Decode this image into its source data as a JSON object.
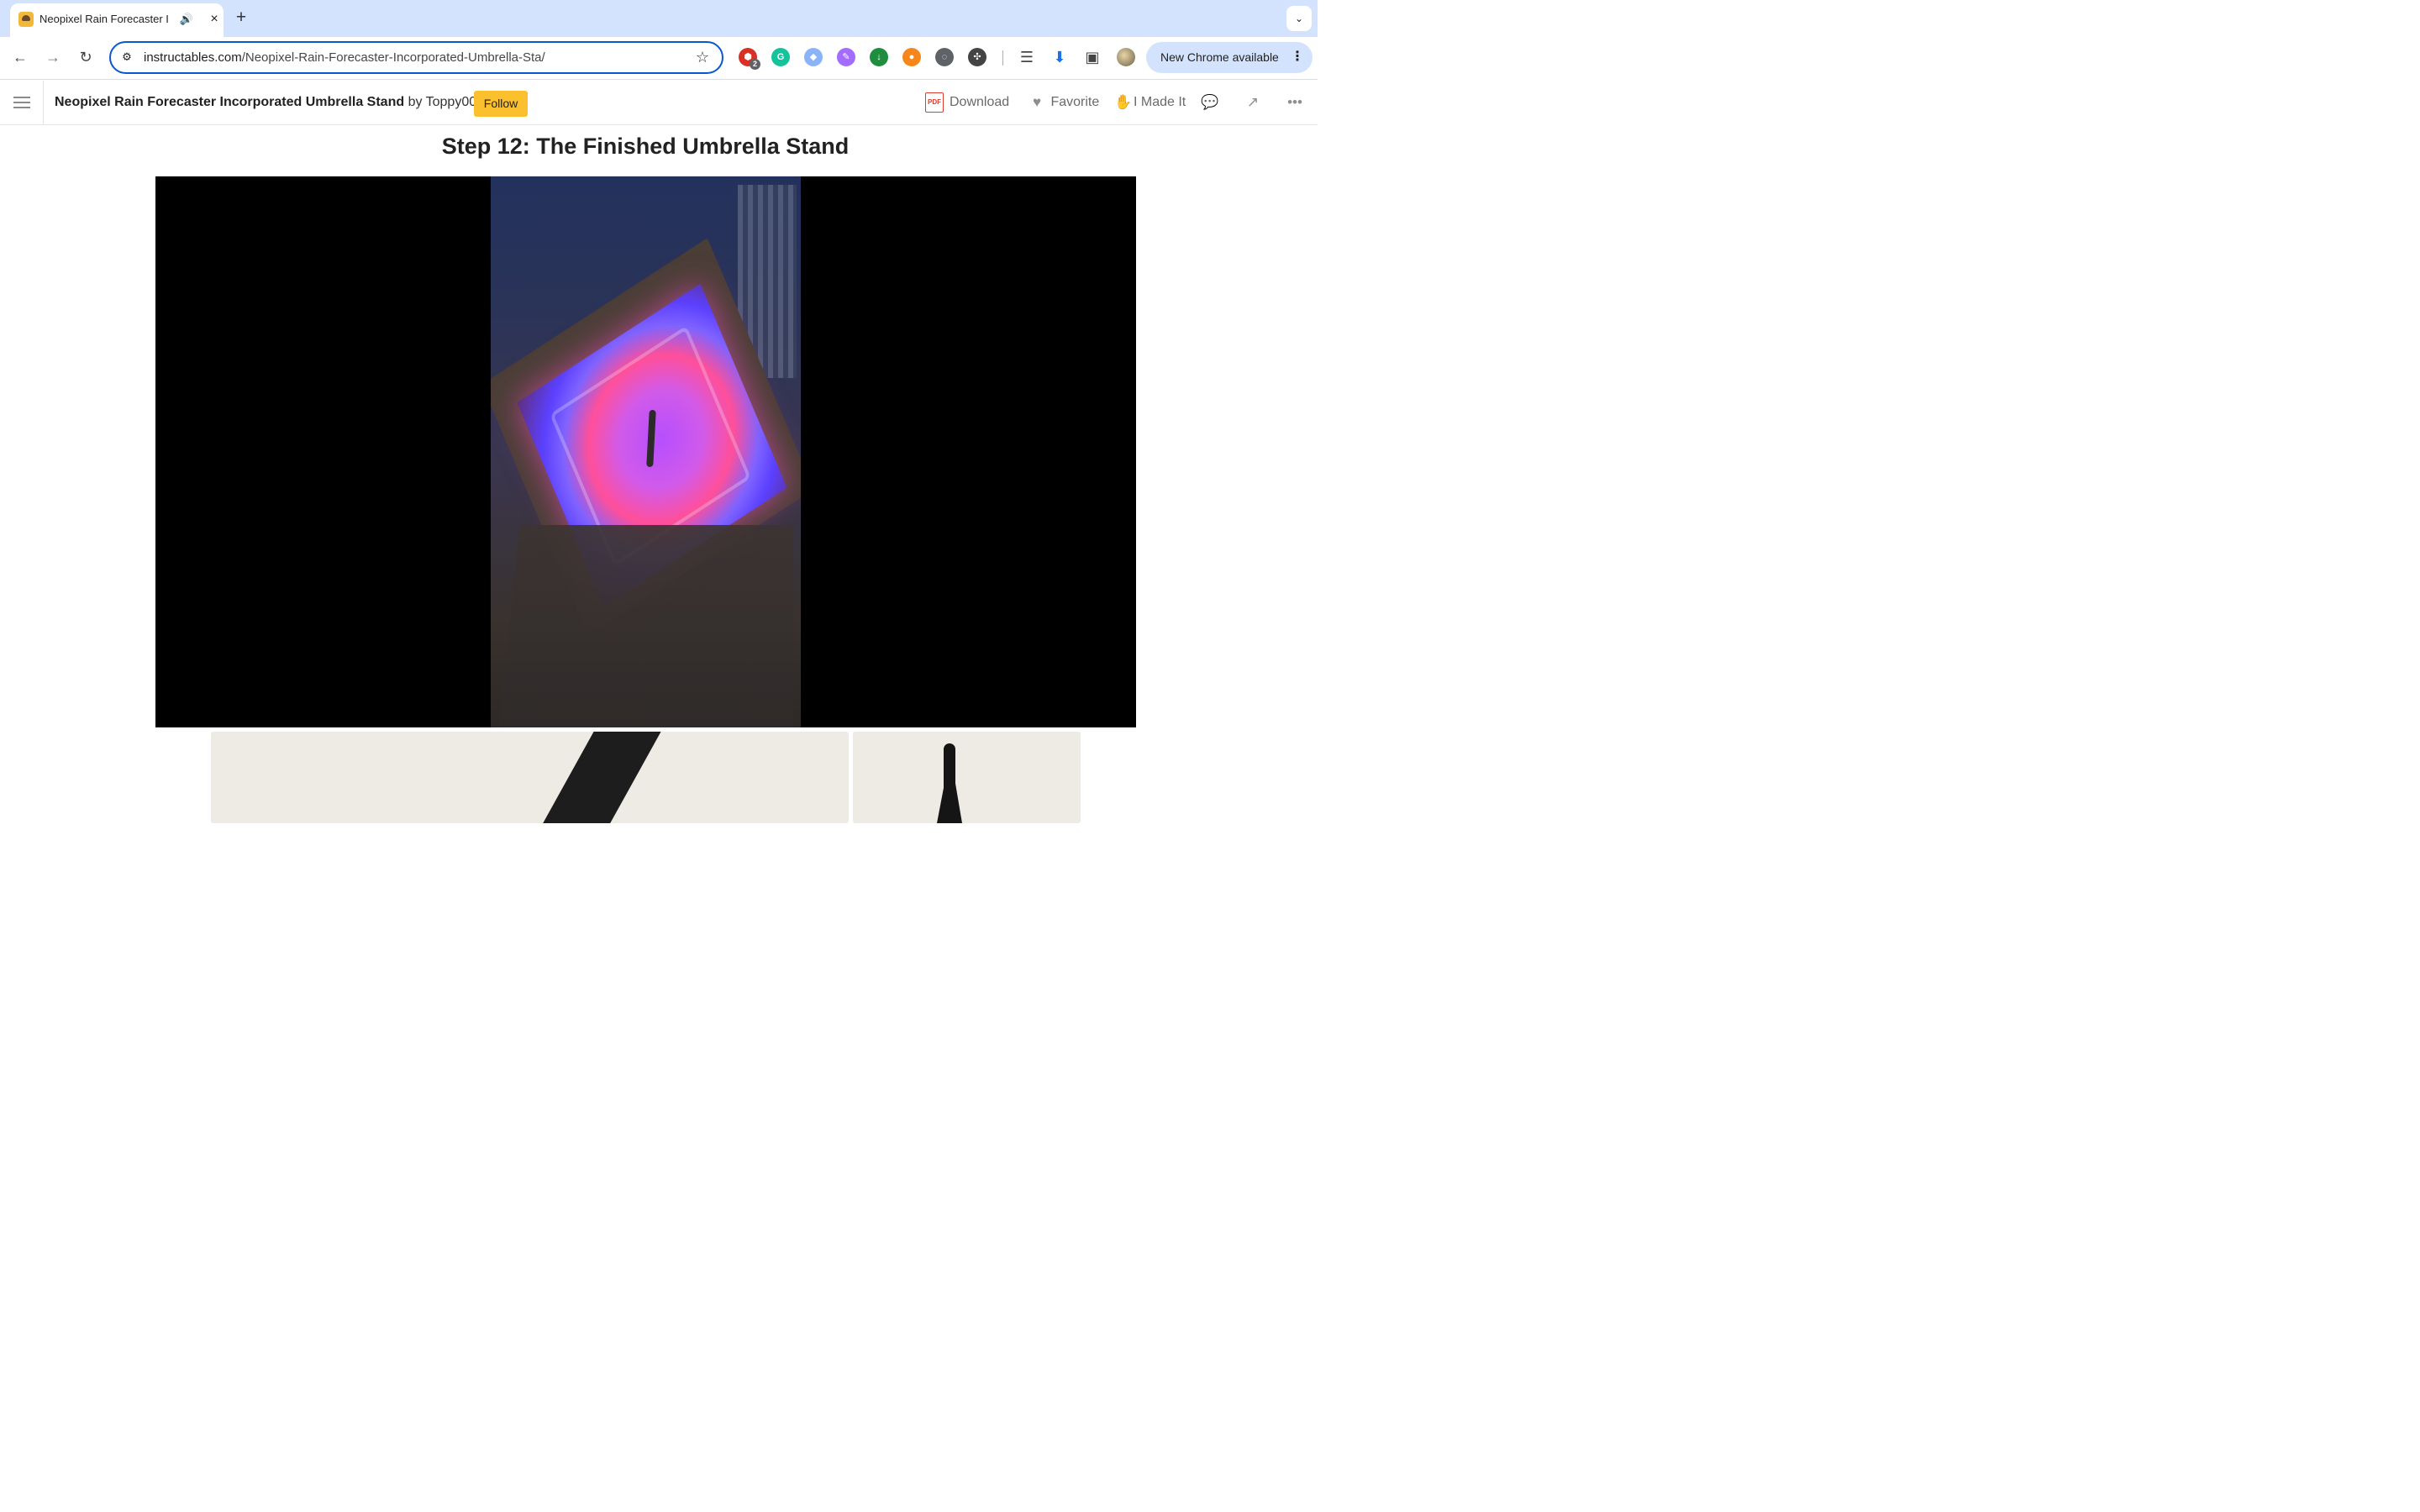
{
  "browser": {
    "tab": {
      "title": "Neopixel Rain Forecaster I",
      "favicon": "instructables-robot-icon",
      "audio_icon": "speaker-icon",
      "close_icon": "close-icon"
    },
    "new_tab_icon": "plus-icon",
    "tab_search_icon": "chevron-down-icon",
    "nav": {
      "back_icon": "arrow-left-icon",
      "forward_icon": "arrow-right-icon",
      "reload_icon": "reload-icon"
    },
    "address_bar": {
      "host": "instructables.com",
      "path": "/Neopixel-Rain-Forecaster-Incorporated-Umbrella-Sta/",
      "site_info_icon": "tune-icon",
      "bookmark_icon": "star-icon"
    },
    "extensions": [
      {
        "name": "adblock-icon",
        "badge": "2",
        "color": "#d93025"
      },
      {
        "name": "grammarly-icon",
        "color": "#15c39a"
      },
      {
        "name": "shield-icon",
        "color": "#8ab4f8"
      },
      {
        "name": "quill-icon",
        "color": "#a36cff"
      },
      {
        "name": "download-arrow-icon",
        "color": "#1e8e3e"
      },
      {
        "name": "metamask-icon",
        "color": "#f6851b"
      },
      {
        "name": "circle-brackets-icon",
        "color": "#5f6368"
      },
      {
        "name": "puzzle-icon",
        "color": "#444444"
      }
    ],
    "toolbar_icons": [
      "media-queue-icon",
      "download-icon",
      "side-panel-icon",
      "profile-avatar"
    ],
    "update_button": {
      "label": "New Chrome available",
      "menu_icon": "more-vert-icon"
    }
  },
  "site_header": {
    "menu_icon": "hamburger-icon",
    "article_title": "Neopixel Rain Forecaster Incorporated Umbrella Stand",
    "by": "by",
    "author": "Toppy007",
    "follow_label": "Follow",
    "actions": [
      {
        "label": "Download",
        "icon": "pdf-icon"
      },
      {
        "label": "Favorite",
        "icon": "heart-icon"
      },
      {
        "label": "I Made It",
        "icon": "hand-icon"
      },
      {
        "label": "",
        "icon": "comments-icon"
      },
      {
        "label": "",
        "icon": "share-icon"
      },
      {
        "label": "",
        "icon": "more-horizontal-icon"
      }
    ],
    "pdf_text": "PDF"
  },
  "content": {
    "step_title": "Step 12: The Finished Umbrella Stand",
    "media": {
      "kind": "photo",
      "subject": "glowing umbrella stand"
    },
    "thumbnails": [
      "umbrella-photo",
      "umbrella-standing-photo"
    ]
  },
  "colors": {
    "chrome_tabstrip": "#d3e3fd",
    "address_outline": "#0b57d0",
    "follow_button": "#fbc02d",
    "media_background": "#000000"
  }
}
